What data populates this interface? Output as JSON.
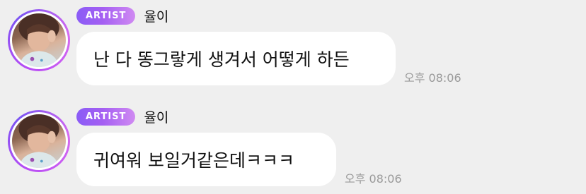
{
  "messages": [
    {
      "badge": "ARTIST",
      "name": "율이",
      "text": "난 다 똥그랗게 생겨서 어떻게 하든",
      "time": "오후 08:06",
      "avatar_icon": "user-avatar-photo"
    },
    {
      "badge": "ARTIST",
      "name": "율이",
      "text": "귀여워 보일거같은데ㅋㅋㅋ",
      "time": "오후 08:06",
      "avatar_icon": "user-avatar-photo"
    }
  ],
  "colors": {
    "background": "#efefef",
    "bubble": "#ffffff",
    "badge_start": "#8a5cf6",
    "badge_end": "#d08af2",
    "timestamp": "#9a9a9a"
  }
}
